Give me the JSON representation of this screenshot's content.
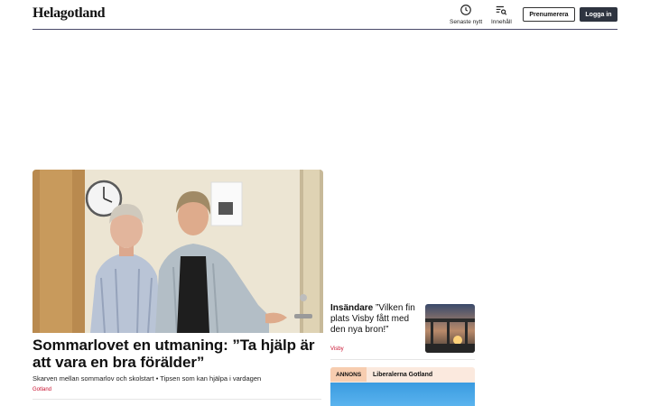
{
  "header": {
    "logo": "Helagotland",
    "nav": [
      {
        "label": "Senaste nytt",
        "icon": "clock-icon"
      },
      {
        "label": "Innehåll",
        "icon": "menu-search-icon"
      }
    ],
    "subscribe_label": "Prenumerera",
    "login_label": "Logga in"
  },
  "main_article": {
    "headline": "Sommarlovet en utmaning: ”Ta hjälp är att vara en bra förälder”",
    "subtitle": "Skarven mellan sommarlov och skolstart • Tipsen som kan hjälpa i vardagen",
    "tag": "Gotland",
    "image": "photo-two-women-in-doorway"
  },
  "side_article": {
    "kicker": "Insändare",
    "quote": "”Vilken fin plats Visby fått med den nya bron!”",
    "tag": "Visby",
    "image": "photo-bridge-sunset"
  },
  "ad": {
    "label": "ANNONS",
    "advertiser": "Liberalerna Gotland"
  },
  "colors": {
    "accent_red": "#c8102e",
    "login_bg": "#2e3440",
    "ad_bg": "#fbe9de"
  }
}
